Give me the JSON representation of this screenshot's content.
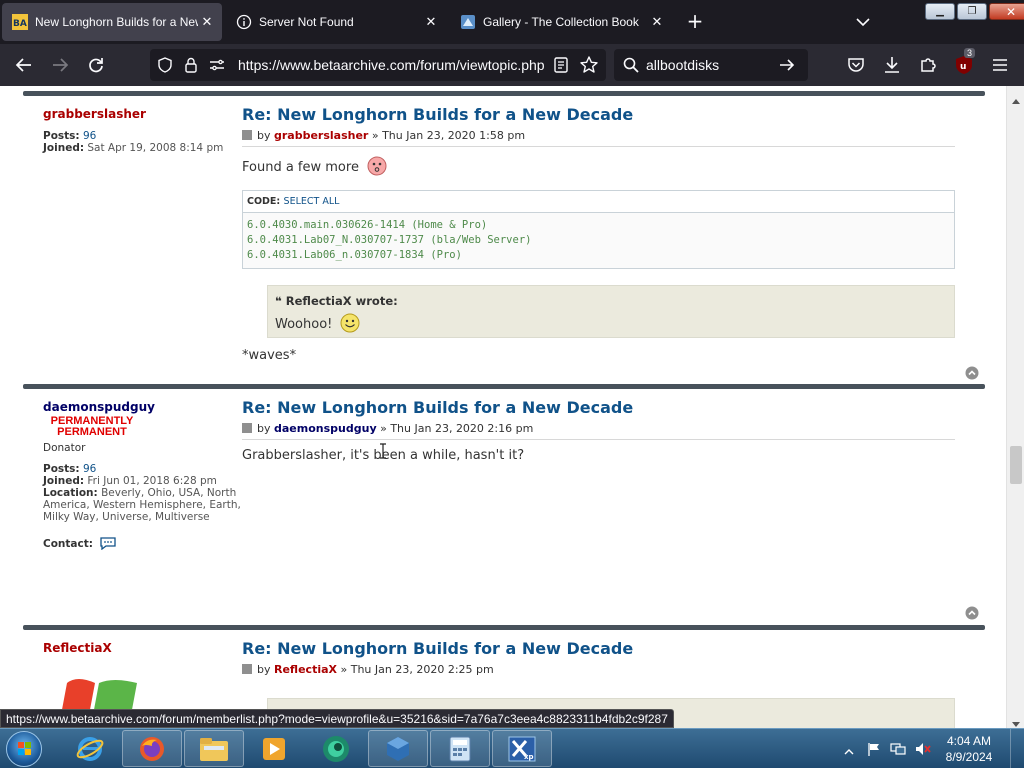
{
  "browser": {
    "tabs": [
      {
        "title": "New Longhorn Builds for a New",
        "favicon": "betaarchive-logo",
        "active": true
      },
      {
        "title": "Server Not Found",
        "favicon": "info-icon",
        "active": false
      },
      {
        "title": "Gallery - The Collection Book",
        "favicon": "collection-book-icon",
        "active": false
      }
    ],
    "url": "https://www.betaarchive.com/forum/viewtopic.php",
    "search_query": "allbootdisks",
    "extension_badge": "3",
    "status_url": "https://www.betaarchive.com/forum/memberlist.php?mode=viewprofile&u=35216&sid=7a76a7c3eea4c8823311b4fdb2c9f287"
  },
  "posts": [
    {
      "author": "grabberslasher",
      "author_color": "#aa0000",
      "posts_label": "Posts:",
      "posts_count": "96",
      "joined_label": "Joined:",
      "joined": "Sat Apr 19, 2008 8:14 pm",
      "title": "Re: New Longhorn Builds for a New Decade",
      "by_label": "by",
      "date": "» Thu Jan 23, 2020 1:58 pm",
      "body_intro": "Found a few more",
      "code": {
        "label": "CODE:",
        "select_all": "SELECT ALL",
        "lines": [
          "6.0.4030.main.030626-1414 (Home & Pro)",
          "6.0.4031.Lab07_N.030707-1737 (bla/Web Server)",
          "6.0.4031.Lab06_n.030707-1834 (Pro)"
        ]
      },
      "quote": {
        "author_line": "ReflectiaX wrote:",
        "text": "Woohoo!"
      },
      "body_outro": "*waves*"
    },
    {
      "author": "daemonspudguy",
      "author_color": "#000066",
      "rank_line1": "PERMANENTLY",
      "rank_line2": "PERMANENT",
      "rank_title": "Donator",
      "posts_label": "Posts:",
      "posts_count": "96",
      "joined_label": "Joined:",
      "joined": "Fri Jun 01, 2018 6:28 pm",
      "location_label": "Location:",
      "location": "Beverly, Ohio, USA, North America, Western Hemisphere, Earth, Milky Way, Universe, Multiverse",
      "contact_label": "Contact:",
      "title": "Re: New Longhorn Builds for a New Decade",
      "by_label": "by",
      "date": "» Thu Jan 23, 2020 2:16 pm",
      "body": "Grabberslasher, it's been a while, hasn't it?"
    },
    {
      "author": "ReflectiaX",
      "author_color": "#aa0000",
      "title": "Re: New Longhorn Builds for a New Decade",
      "by_label": "by",
      "date": "» Thu Jan 23, 2020 2:25 pm"
    }
  ],
  "taskbar": {
    "time": "4:04 AM",
    "date": "8/9/2024",
    "apps": [
      "internet-explorer",
      "firefox",
      "file-explorer",
      "media-player",
      "browser-globe",
      "virtualbox",
      "calculator",
      "windows-xp-mode"
    ]
  }
}
